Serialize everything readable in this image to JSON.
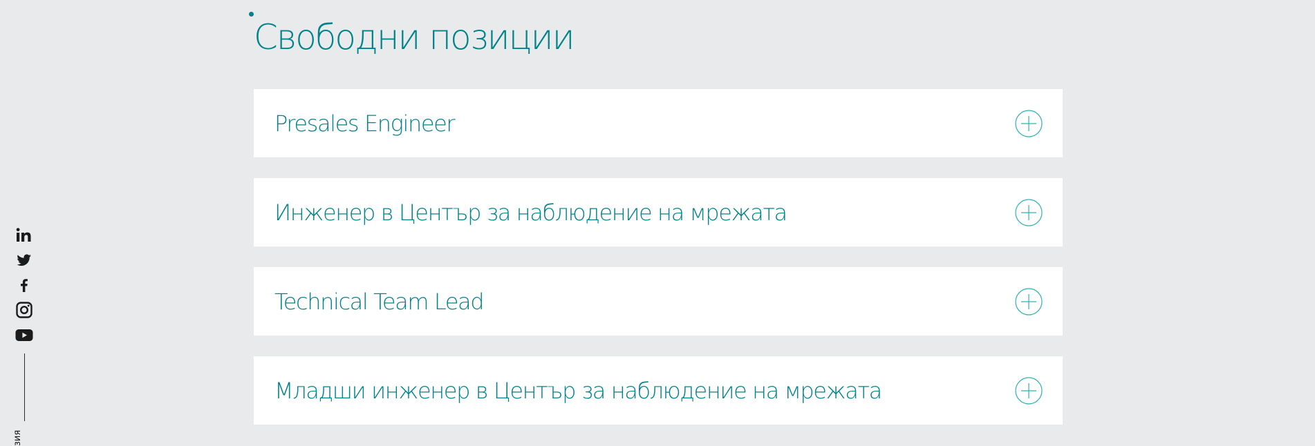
{
  "section": {
    "title": "Свободни позиции"
  },
  "positions": [
    {
      "title": "Presales Engineer",
      "toggle_icon": "plus-circle-icon"
    },
    {
      "title": "Инженер в Център за наблюдение на мрежата",
      "toggle_icon": "plus-circle-icon"
    },
    {
      "title": "Technical Team Lead",
      "toggle_icon": "plus-circle-icon"
    },
    {
      "title": "Младши инженер в Център за наблюдение на мрежата",
      "toggle_icon": "plus-circle-icon"
    }
  ],
  "social": {
    "icons": [
      "linkedin-icon",
      "twitter-icon",
      "facebook-icon",
      "instagram-icon",
      "youtube-icon"
    ],
    "side_label": "зия"
  },
  "colors": {
    "accent": "#00838a",
    "icon_accent": "#2bb3ad",
    "background": "#e9eaeb",
    "card": "#ffffff",
    "social_icon": "#1b1b1b"
  }
}
